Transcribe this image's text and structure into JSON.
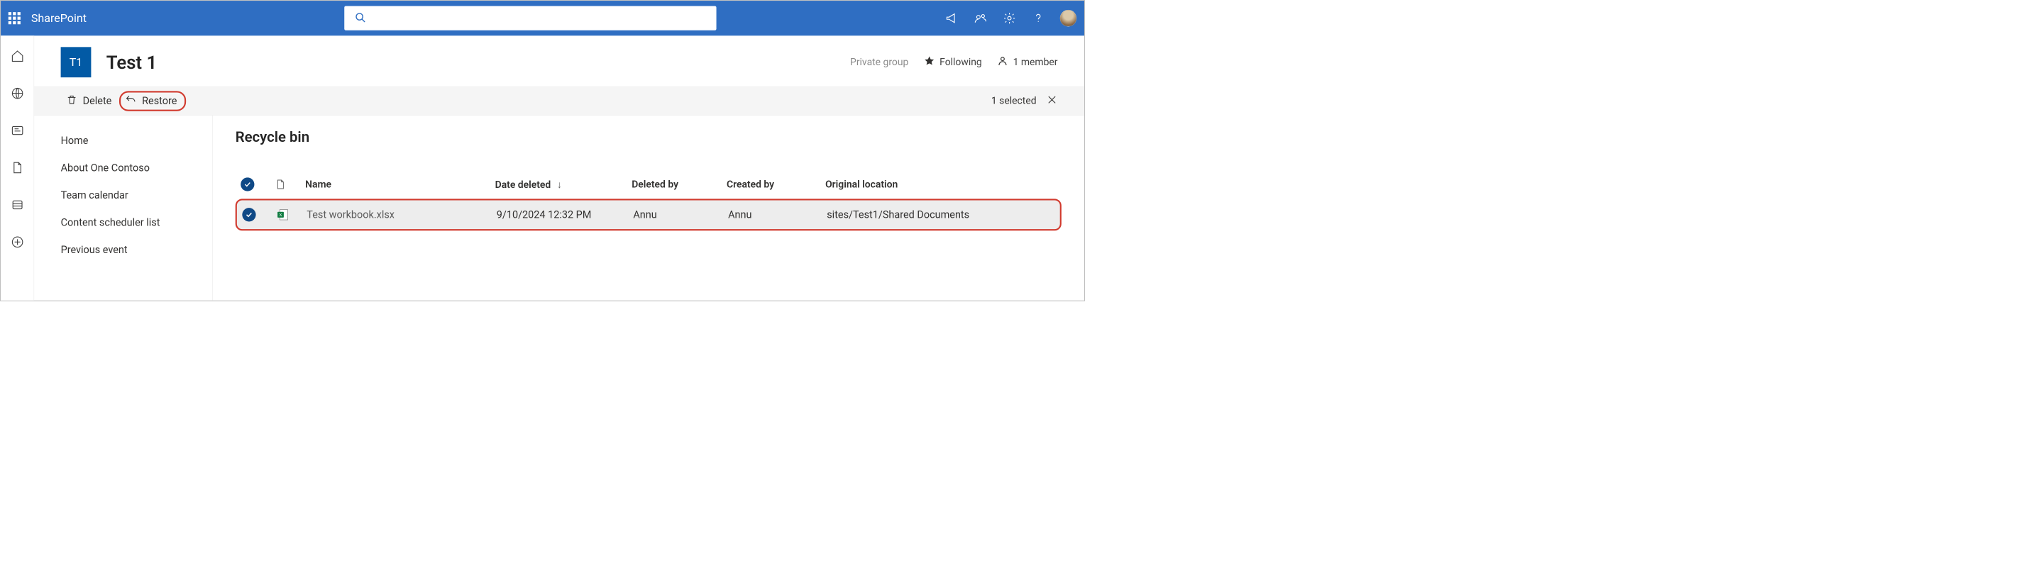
{
  "header": {
    "brand": "SharePoint"
  },
  "search": {
    "placeholder": ""
  },
  "site": {
    "logo_initials": "T1",
    "title": "Test 1",
    "privacy_label": "Private group",
    "following_label": "Following",
    "members_label": "1 member"
  },
  "commands": {
    "delete_label": "Delete",
    "restore_label": "Restore",
    "selected_label": "1 selected"
  },
  "nav": {
    "items": [
      "Home",
      "About One Contoso",
      "Team calendar",
      "Content scheduler list",
      "Previous event"
    ]
  },
  "page": {
    "title": "Recycle bin"
  },
  "table": {
    "columns": {
      "name": "Name",
      "date_deleted": "Date deleted",
      "deleted_by": "Deleted by",
      "created_by": "Created by",
      "original_location": "Original location"
    },
    "rows": [
      {
        "name": "Test workbook.xlsx",
        "date_deleted": "9/10/2024 12:32 PM",
        "deleted_by": "Annu",
        "created_by": "Annu",
        "original_location": "sites/Test1/Shared Documents"
      }
    ]
  }
}
